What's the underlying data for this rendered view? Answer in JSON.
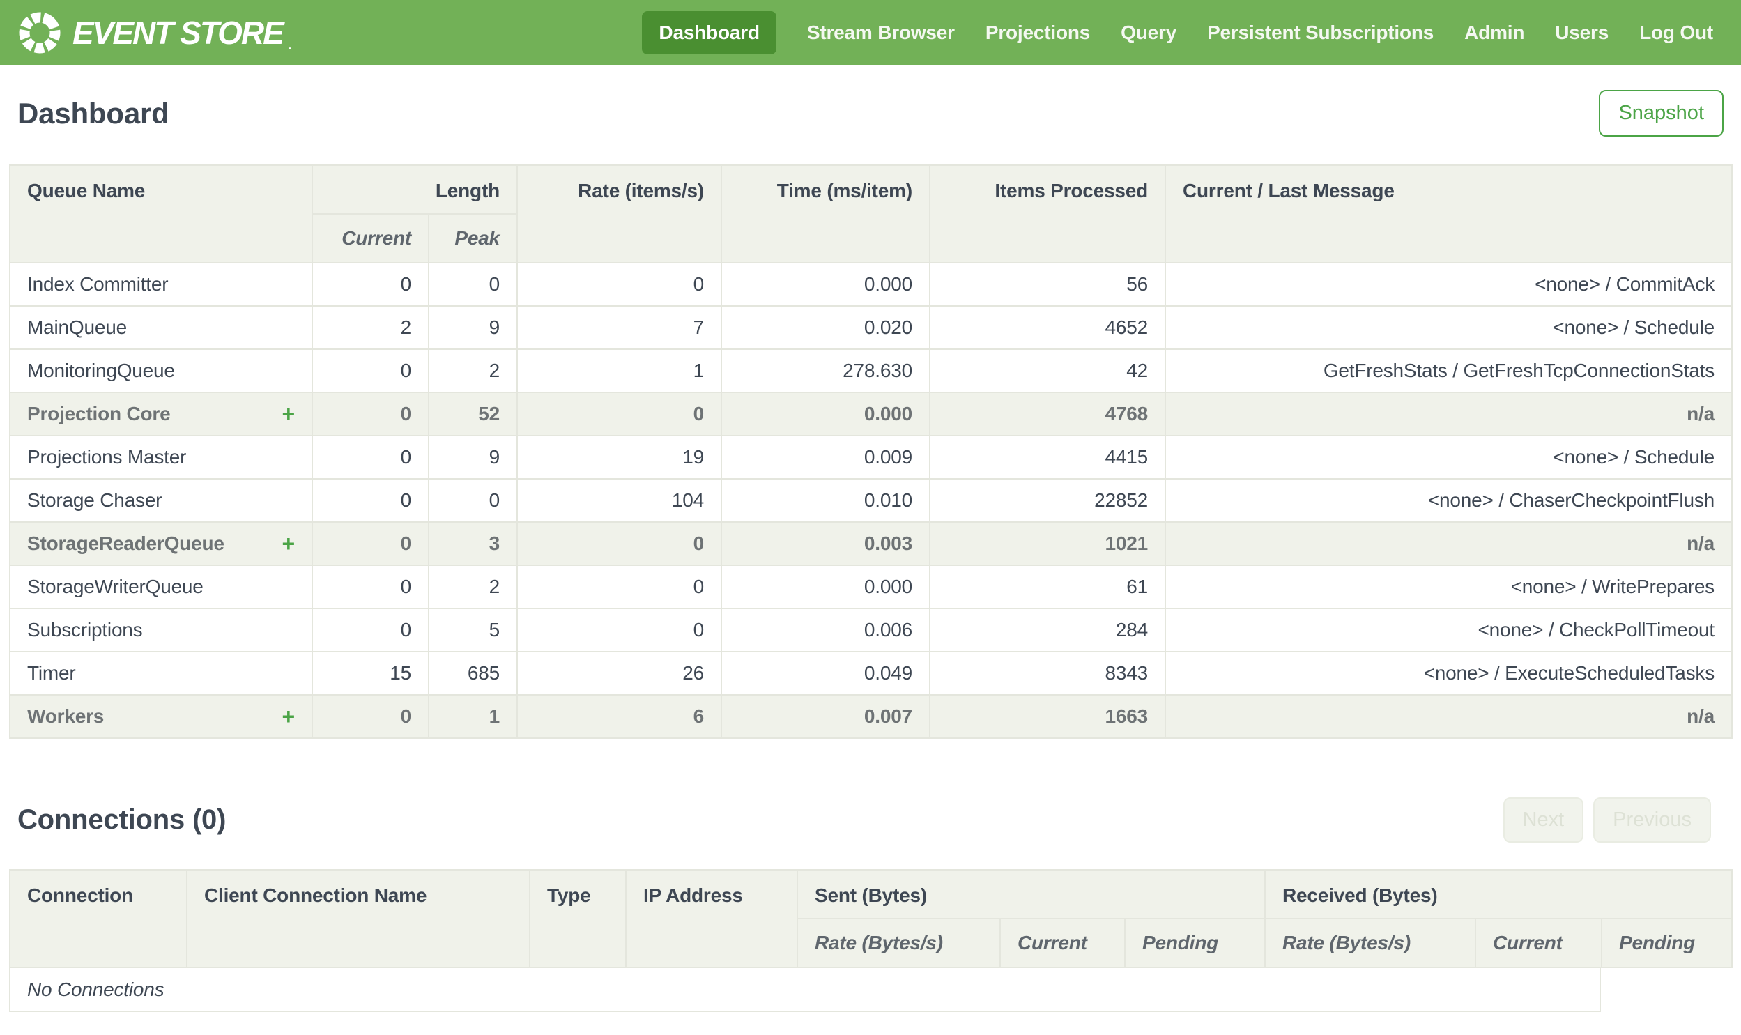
{
  "colors": {
    "nav_green": "#72b157",
    "nav_active_green": "#4a8f31",
    "accent_green": "#4ba446",
    "header_bg": "#f0f2ea",
    "border": "#e4e6dd",
    "text_dark": "#3e4753",
    "text_muted": "#6e7375"
  },
  "nav": {
    "brand": "EVENT STORE",
    "brand_mark": ".",
    "items": [
      {
        "label": "Dashboard",
        "active": true
      },
      {
        "label": "Stream Browser"
      },
      {
        "label": "Projections"
      },
      {
        "label": "Query"
      },
      {
        "label": "Persistent Subscriptions"
      },
      {
        "label": "Admin"
      },
      {
        "label": "Users"
      },
      {
        "label": "Log Out"
      }
    ]
  },
  "page": {
    "title": "Dashboard",
    "snapshot_label": "Snapshot"
  },
  "queues": {
    "headers": {
      "queue_name": "Queue Name",
      "length": "Length",
      "current": "Current",
      "peak": "Peak",
      "rate": "Rate (items/s)",
      "time": "Time (ms/item)",
      "items_processed": "Items Processed",
      "message": "Current / Last Message"
    },
    "rows": [
      {
        "name": "Index Committer",
        "current": "0",
        "peak": "0",
        "rate": "0",
        "time": "0.000",
        "items": "56",
        "message": "<none> / CommitAck"
      },
      {
        "name": "MainQueue",
        "current": "2",
        "peak": "9",
        "rate": "7",
        "time": "0.020",
        "items": "4652",
        "message": "<none> / Schedule"
      },
      {
        "name": "MonitoringQueue",
        "current": "0",
        "peak": "2",
        "rate": "1",
        "time": "278.630",
        "items": "42",
        "message": "GetFreshStats / GetFreshTcpConnectionStats"
      },
      {
        "name": "Projection Core",
        "group": true,
        "expandable": true,
        "expander": "+",
        "current": "0",
        "peak": "52",
        "rate": "0",
        "time": "0.000",
        "items": "4768",
        "message": "n/a"
      },
      {
        "name": "Projections Master",
        "current": "0",
        "peak": "9",
        "rate": "19",
        "time": "0.009",
        "items": "4415",
        "message": "<none> / Schedule"
      },
      {
        "name": "Storage Chaser",
        "current": "0",
        "peak": "0",
        "rate": "104",
        "time": "0.010",
        "items": "22852",
        "message": "<none> / ChaserCheckpointFlush"
      },
      {
        "name": "StorageReaderQueue",
        "group": true,
        "expandable": true,
        "expander": "+",
        "current": "0",
        "peak": "3",
        "rate": "0",
        "time": "0.003",
        "items": "1021",
        "message": "n/a"
      },
      {
        "name": "StorageWriterQueue",
        "current": "0",
        "peak": "2",
        "rate": "0",
        "time": "0.000",
        "items": "61",
        "message": "<none> / WritePrepares"
      },
      {
        "name": "Subscriptions",
        "current": "0",
        "peak": "5",
        "rate": "0",
        "time": "0.006",
        "items": "284",
        "message": "<none> / CheckPollTimeout"
      },
      {
        "name": "Timer",
        "current": "15",
        "peak": "685",
        "rate": "26",
        "time": "0.049",
        "items": "8343",
        "message": "<none> / ExecuteScheduledTasks"
      },
      {
        "name": "Workers",
        "group": true,
        "expandable": true,
        "expander": "+",
        "current": "0",
        "peak": "1",
        "rate": "6",
        "time": "0.007",
        "items": "1663",
        "message": "n/a"
      }
    ]
  },
  "connections": {
    "title": "Connections (0)",
    "pagination": {
      "next": "Next",
      "previous": "Previous"
    },
    "headers": {
      "connection": "Connection",
      "client_name": "Client Connection Name",
      "type": "Type",
      "ip": "IP Address",
      "sent": "Sent (Bytes)",
      "received": "Received (Bytes)",
      "sent_rate": "Rate (Bytes/s)",
      "sent_current": "Current",
      "sent_pending": "Pending",
      "received_rate": "Rate (Bytes/s)",
      "received_current": "Current",
      "received_pending": "Pending"
    },
    "empty_message": "No Connections"
  }
}
